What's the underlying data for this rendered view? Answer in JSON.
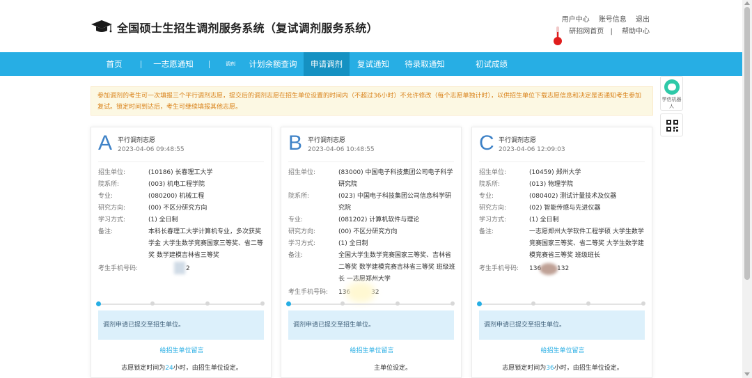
{
  "header": {
    "title": "全国硕士生招生调剂服务系统（复试调剂服务系统）",
    "links_row1": [
      "用户中心",
      "账号信息",
      "退出"
    ],
    "links_row2": [
      "研招网首页",
      "|",
      "帮助中心"
    ]
  },
  "nav": {
    "items": [
      "首页",
      "一志愿通知",
      "计划余额查询",
      "申请调剂",
      "复试通知",
      "待录取通知",
      "初试成绩"
    ],
    "small_label": "调剂",
    "active": "申请调剂"
  },
  "notice": {
    "text": "参加调剂的考生可一次填报三个平行调剂志愿，提交后的调剂志愿在招生单位设置的时间内（不超过36小时）不允许修改（每个志愿单独计时），以供招生单位下载志愿信息和决定是否通知考生参加复试。锁定时间到达后，考生可继续填报其他志愿。"
  },
  "side": {
    "robot_label": "学信机器人"
  },
  "labels": {
    "unit": "招生单位:",
    "dept": "院系所:",
    "major": "专业:",
    "direction": "研究方向:",
    "mode": "学习方式:",
    "remark": "备注:",
    "phone": "考生手机号码:"
  },
  "cards": [
    {
      "letter": "A",
      "type": "平行调剂志愿",
      "time": "2023-04-06 09:48:55",
      "unit": "(10186) 长春理工大学",
      "dept": "(003) 机电工程学院",
      "major": "(080200) 机械工程",
      "direction": "(00) 不区分研究方向",
      "mode": "(1) 全日制",
      "remark": "本科长春理工大学计算机专业，多次获奖学金 大学生数学竞赛国家三等奖、省二等奖 数学建模吉林省三等奖",
      "phone": "2",
      "status": "调剂申请已提交至招生单位。",
      "msg_link": "给招生单位留言",
      "lock_prefix": "志愿锁定时间为",
      "lock_hours": "24",
      "lock_suffix": "小时，由招生单位设定。"
    },
    {
      "letter": "B",
      "type": "平行调剂志愿",
      "time": "2023-04-06 10:48:55",
      "unit": "(83000) 中国电子科技集团公司电子科学研究院",
      "dept": "(023) 中国电子科技集团公司信息科学研究院",
      "major": "(081202) 计算机软件与理论",
      "direction": "(00) 不区分研究方向",
      "mode": "(1) 全日制",
      "remark": "全国大学生数学竞赛国家三等奖、吉林省二等奖 数学建模竞赛吉林省三等奖 班级班长 一志愿郑州大学",
      "phone": "136",
      "phone_tail": "32",
      "status": "调剂申请已提交至招生单位。",
      "msg_link": "给招生单位留言",
      "lock_tail": "主单位设定。"
    },
    {
      "letter": "C",
      "type": "平行调剂志愿",
      "time": "2023-04-06 12:09:03",
      "unit": "(10459) 郑州大学",
      "dept": "(013) 物理学院",
      "major": "(080402) 测试计量技术及仪器",
      "direction": "(02) 智能传感与先进仪器",
      "mode": "(1) 全日制",
      "remark": "一志愿郑州大学软件工程学硕 大学生数学竞赛国家三等奖、省二等奖 大学生数学建模竞赛省三等奖 班级班长",
      "phone": "136",
      "phone_tail": "132",
      "status": "调剂申请已提交至招生单位。",
      "msg_link": "给招生单位留言",
      "lock_prefix": "志愿锁定时间为",
      "lock_hours": "36",
      "lock_suffix": "小时，由招生单位设定。"
    }
  ],
  "colors": {
    "nav_bg": "#27aee4",
    "nav_active": "#1591c2",
    "accent": "#27aee4",
    "notice_text": "#d9821a",
    "letter": "#3e82c7"
  }
}
